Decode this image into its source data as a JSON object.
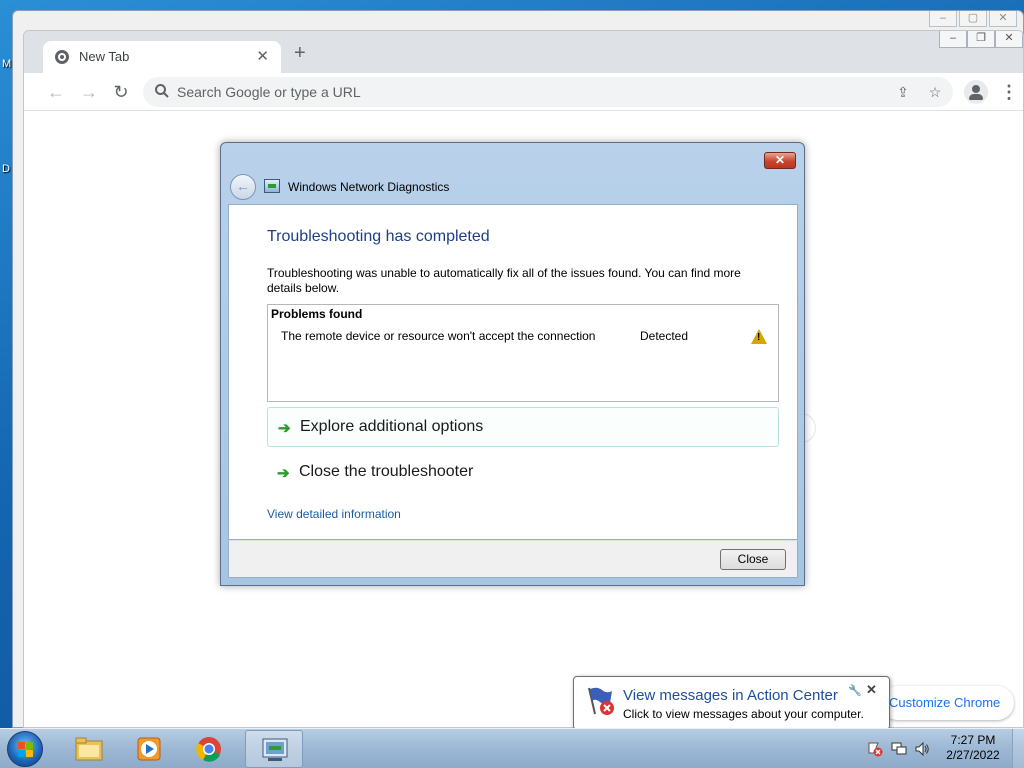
{
  "desktop": {
    "edge_labels": [
      "M",
      "D"
    ]
  },
  "chrome": {
    "tab": {
      "title": "New Tab",
      "close": "✕"
    },
    "new_tab": "+",
    "nav": {
      "back": "←",
      "forward": "→",
      "reload": "↻"
    },
    "omnibox_placeholder": "Search Google or type a URL",
    "customize_label": "Customize Chrome"
  },
  "dialog": {
    "title": "Windows Network Diagnostics",
    "heading": "Troubleshooting has completed",
    "description": "Troubleshooting was unable to automatically fix all of the issues found. You can find more details below.",
    "problems": {
      "title": "Problems found",
      "items": [
        {
          "text": "The remote device or resource won't accept the connection",
          "status": "Detected",
          "icon": "warning-icon"
        }
      ]
    },
    "options": [
      {
        "label": "Explore additional options"
      },
      {
        "label": "Close the troubleshooter"
      }
    ],
    "detail_link": "View detailed information",
    "close_button": "Close"
  },
  "balloon": {
    "title": "View messages in Action Center",
    "text": "Click to view messages about your computer."
  },
  "taskbar": {
    "items": [
      {
        "name": "windows-explorer",
        "icon": "folder-icon"
      },
      {
        "name": "windows-media-player",
        "icon": "media-player-icon"
      },
      {
        "name": "google-chrome",
        "icon": "chrome-icon"
      },
      {
        "name": "network-diagnostics",
        "icon": "network-diagnostics-icon"
      }
    ],
    "clock": {
      "time": "7:27 PM",
      "date": "2/27/2022"
    }
  },
  "colors": {
    "dialog_heading": "#1e3f87",
    "link": "#1c5c9e",
    "chrome_accent": "#1a73e8",
    "warning": "#d8a400"
  }
}
